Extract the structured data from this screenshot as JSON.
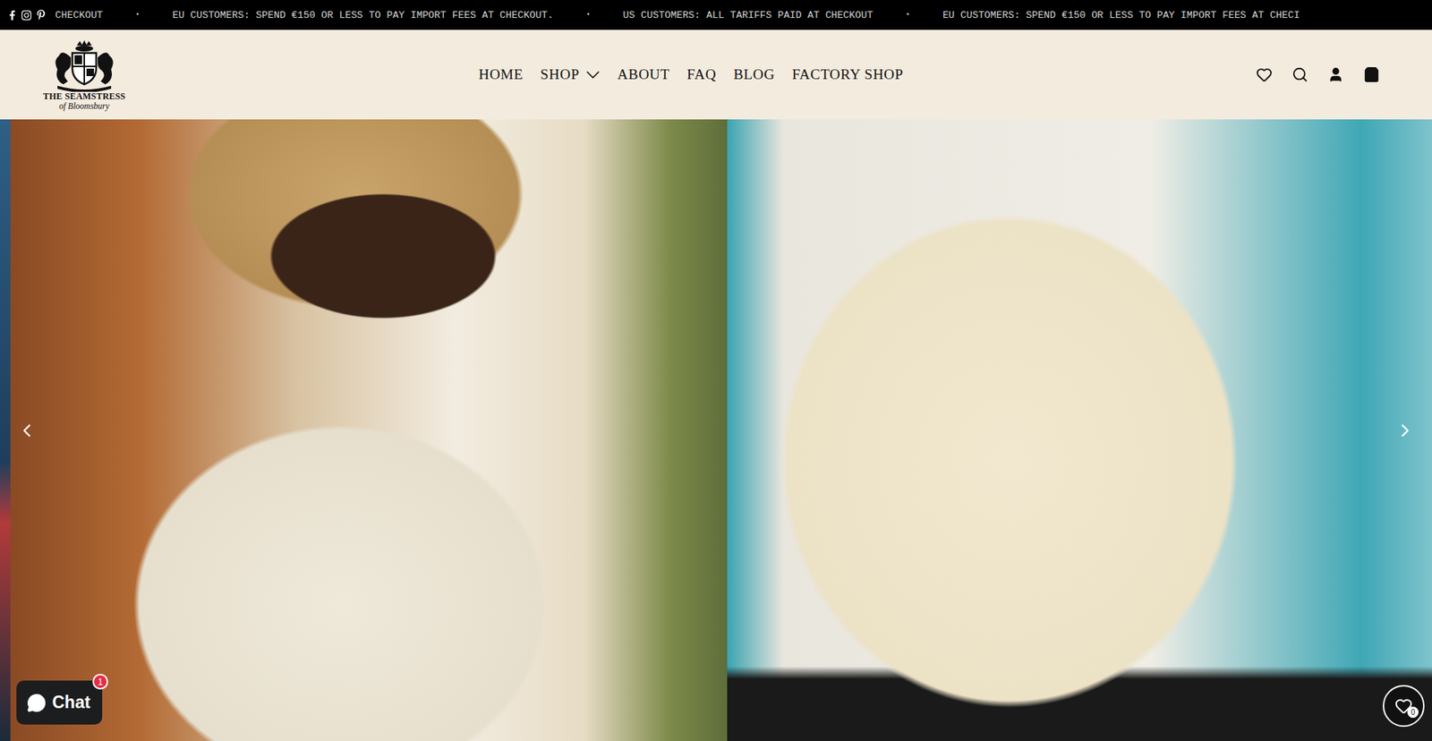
{
  "announcement_bar": {
    "items": [
      {
        "text": "CHECKOUT",
        "kind": "message"
      },
      {
        "text": "•",
        "kind": "separator"
      },
      {
        "text": "EU CUSTOMERS: SPEND €150 OR LESS TO PAY IMPORT FEES AT CHECKOUT.",
        "kind": "message"
      },
      {
        "text": "•",
        "kind": "separator"
      },
      {
        "text": "US CUSTOMERS: ALL TARIFFS PAID AT CHECKOUT",
        "kind": "message"
      },
      {
        "text": "•",
        "kind": "separator"
      },
      {
        "text": "EU CUSTOMERS: SPEND €150 OR LESS TO PAY IMPORT FEES AT CHECI",
        "kind": "message"
      }
    ]
  },
  "logo": {
    "title": "THE SEAMSTRESS",
    "subtitle": "of Bloomsbury"
  },
  "nav": [
    {
      "label": "HOME",
      "has_dropdown": false
    },
    {
      "label": "SHOP",
      "has_dropdown": true
    },
    {
      "label": "ABOUT",
      "has_dropdown": false
    },
    {
      "label": "FAQ",
      "has_dropdown": false
    },
    {
      "label": "BLOG",
      "has_dropdown": false
    },
    {
      "label": "FACTORY SHOP",
      "has_dropdown": false
    }
  ],
  "chat": {
    "label": "Chat",
    "badge": "1"
  },
  "wishlist": {
    "count": "0"
  }
}
